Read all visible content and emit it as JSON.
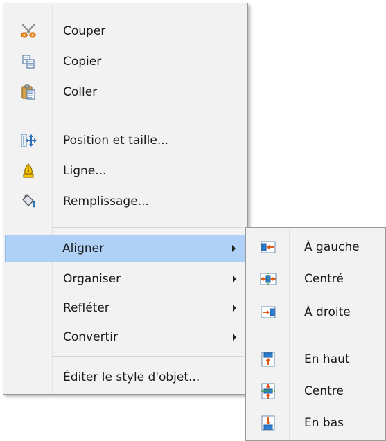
{
  "main_menu": {
    "items": [
      {
        "label": "Couper",
        "icon": "scissors-icon"
      },
      {
        "label": "Copier",
        "icon": "copy-icon"
      },
      {
        "label": "Coller",
        "icon": "paste-icon"
      },
      {
        "label": "Position et taille...",
        "icon": "position-size-icon"
      },
      {
        "label": "Ligne...",
        "icon": "line-pen-icon"
      },
      {
        "label": "Remplissage...",
        "icon": "fill-bucket-icon"
      },
      {
        "label": "Aligner",
        "submenu": true,
        "highlighted": true
      },
      {
        "label": "Organiser",
        "submenu": true
      },
      {
        "label": "Refléter",
        "submenu": true
      },
      {
        "label": "Convertir",
        "submenu": true
      },
      {
        "label": "Éditer le style d'objet..."
      }
    ]
  },
  "align_submenu": {
    "items": [
      {
        "label": "À gauche",
        "icon": "align-left-icon"
      },
      {
        "label": "Centré",
        "icon": "align-center-horizontal-icon"
      },
      {
        "label": "À droite",
        "icon": "align-right-icon"
      },
      {
        "label": "En haut",
        "icon": "align-top-icon"
      },
      {
        "label": "Centre",
        "icon": "align-center-vertical-icon"
      },
      {
        "label": "En bas",
        "icon": "align-bottom-icon"
      }
    ]
  },
  "colors": {
    "highlight": "#aed1f5",
    "menu_background": "#f2f2f2"
  }
}
